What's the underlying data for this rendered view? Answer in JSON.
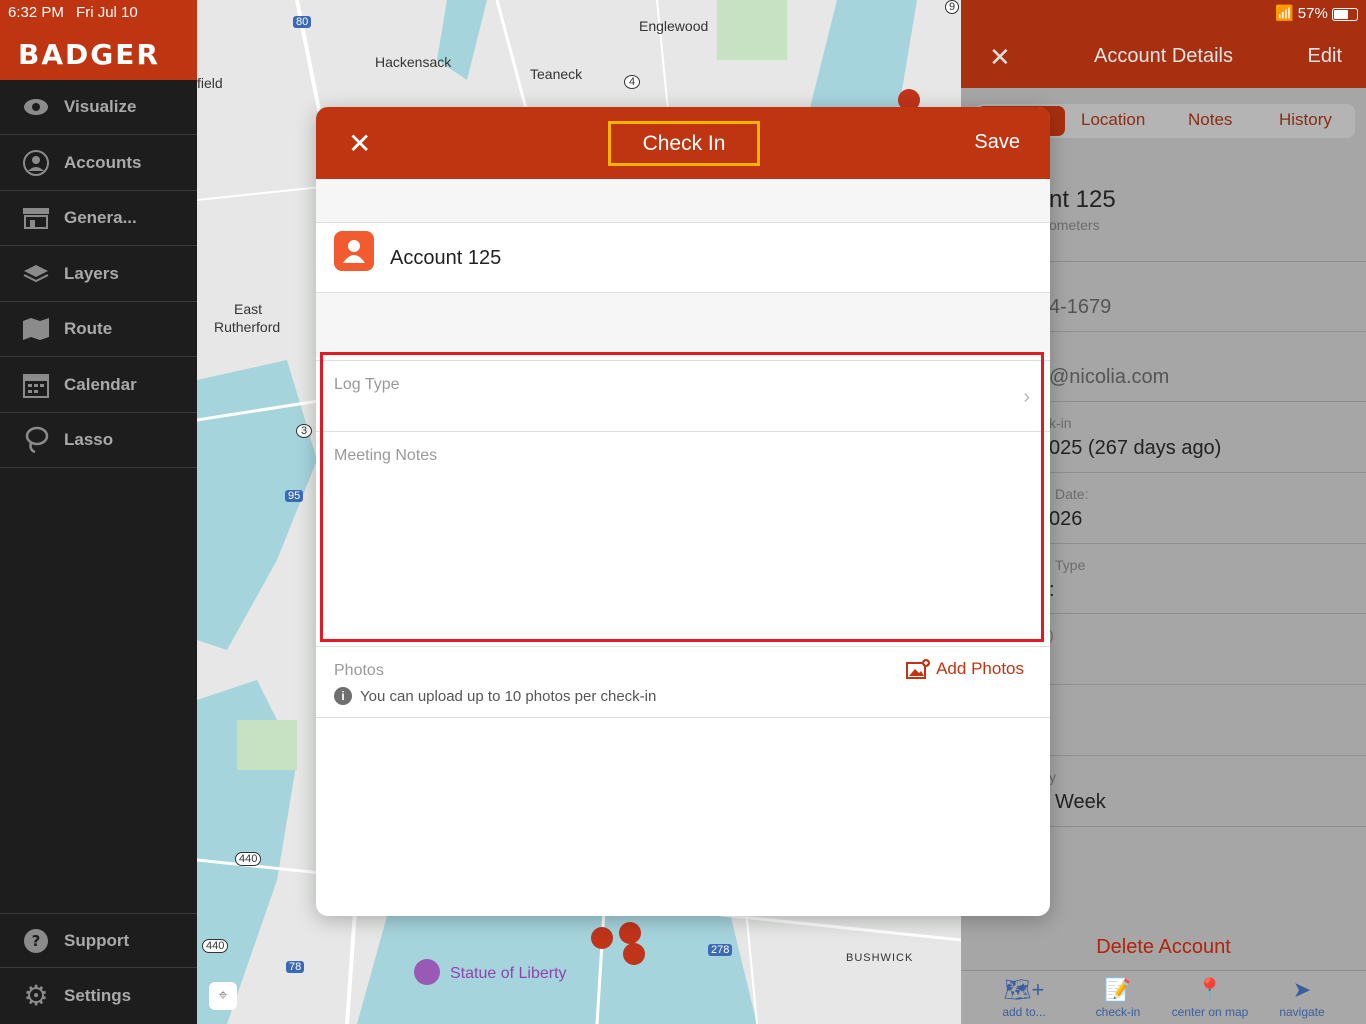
{
  "status_bar": {
    "time": "6:32 PM",
    "date": "Fri Jul 10",
    "battery": "57%"
  },
  "sidebar": {
    "brand": "BADGER",
    "items": [
      {
        "label": "Visualize",
        "icon": "eye-icon"
      },
      {
        "label": "Accounts",
        "icon": "person-circle-icon"
      },
      {
        "label": "Genera...",
        "icon": "store-icon"
      },
      {
        "label": "Layers",
        "icon": "layers-icon"
      },
      {
        "label": "Route",
        "icon": "map-icon"
      },
      {
        "label": "Calendar",
        "icon": "calendar-icon"
      },
      {
        "label": "Lasso",
        "icon": "lasso-icon"
      }
    ],
    "bottom_items": [
      {
        "label": "Support",
        "icon": "question-icon"
      },
      {
        "label": "Settings",
        "icon": "gear-icon"
      }
    ]
  },
  "map": {
    "labels": [
      "Englewood",
      "Hackensack",
      "Teaneck",
      "East",
      "Rutherford",
      "field",
      "Statue of Liberty",
      "BUSHWICK"
    ],
    "shields": [
      "80",
      "4",
      "3",
      "95",
      "440",
      "440",
      "78",
      "278",
      "9"
    ]
  },
  "account_details": {
    "title": "Account Details",
    "close": "✕",
    "edit": "Edit",
    "tabs": [
      "Location",
      "Notes",
      "History"
    ],
    "rows": [
      {
        "value": "nt 125",
        "sub": "ometers"
      },
      {
        "value": "4-1679"
      },
      {
        "value": "@nicolia.com"
      },
      {
        "sub": "k-in",
        "value": "025 (267 days ago)"
      },
      {
        "sub": "Date:",
        "value": "026"
      },
      {
        "sub": "Type",
        "value": ":"
      },
      {
        "sub": ")"
      },
      {
        "sub": "y",
        "value": "Week"
      }
    ],
    "delete": "Delete Account",
    "toolbar": [
      {
        "label": "add to...",
        "icon": "map-plus-icon"
      },
      {
        "label": "check-in",
        "icon": "checkin-icon"
      },
      {
        "label": "center on map",
        "icon": "pin-icon"
      },
      {
        "label": "navigate",
        "icon": "navigate-icon"
      }
    ]
  },
  "modal": {
    "close": "✕",
    "title": "Check In",
    "save": "Save",
    "account_name": "Account 125",
    "log_type": "Log Type",
    "meeting_notes": "Meeting Notes",
    "photos_label": "Photos",
    "add_photos": "Add Photos",
    "info": "You can upload up to 10 photos per check-in"
  },
  "colors": {
    "brand": "#bf3511",
    "highlight_title": "#f5b400",
    "highlight_form": "#e01b24"
  }
}
